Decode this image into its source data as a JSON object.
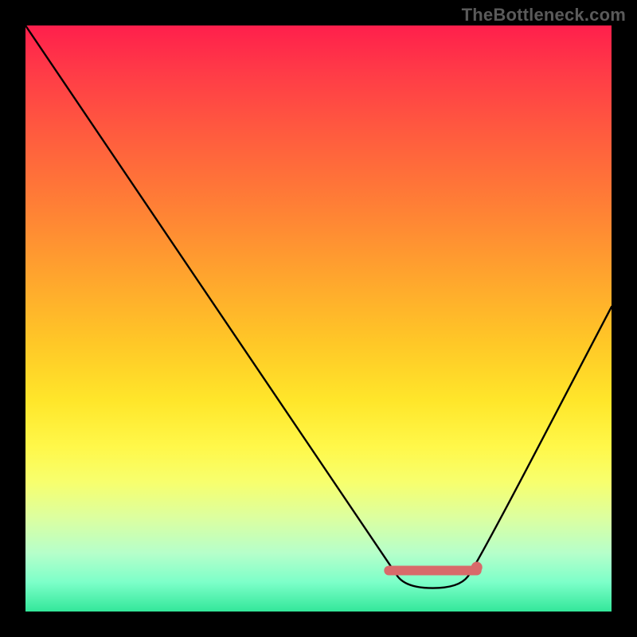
{
  "watermark": "TheBottleneck.com",
  "chart_data": {
    "type": "line",
    "title": "",
    "xlabel": "",
    "ylabel": "",
    "xlim": [
      0,
      100
    ],
    "ylim": [
      0,
      100
    ],
    "series": [
      {
        "name": "curve",
        "x": [
          0,
          62,
          65,
          74,
          77,
          100
        ],
        "values": [
          100,
          8,
          4,
          4,
          8,
          52
        ]
      }
    ],
    "annotations": [
      {
        "name": "valley-band",
        "x_range": [
          62,
          77
        ],
        "y": 7,
        "color": "#d86a6a"
      }
    ],
    "background": {
      "type": "vertical-gradient",
      "top_color": "#ff1f4c",
      "bottom_color": "#33e79a"
    }
  }
}
